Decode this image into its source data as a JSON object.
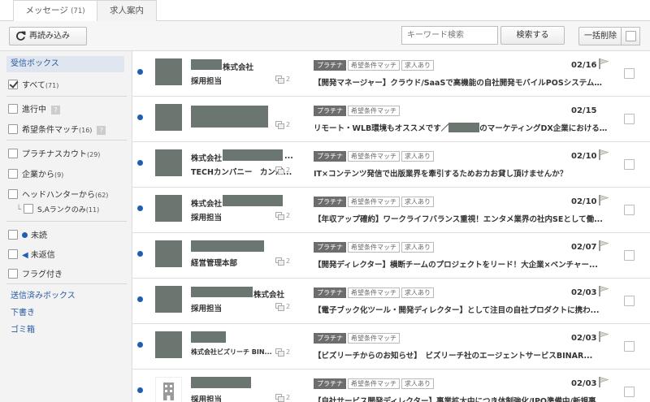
{
  "tabs": {
    "messages_label": "メッセージ",
    "messages_count": "(71)",
    "jobs_label": "求人案内"
  },
  "toolbar": {
    "reload_label": "再読み込み",
    "search_placeholder": "キーワード検索",
    "search_button": "検索する",
    "bulk_delete": "一括削除"
  },
  "sidebar": {
    "inbox": "受信ボックス",
    "all_label": "すべて",
    "all_count": "(71)",
    "in_progress": "進行中",
    "match": "希望条件マッチ",
    "match_count": "(16)",
    "platinum_scout": "プラチナスカウト",
    "platinum_count": "(29)",
    "from_company": "企業から",
    "from_company_count": "(9)",
    "headhunter": "ヘッドハンターから",
    "headhunter_count": "(62)",
    "s_rank": "S,Aランクのみ",
    "s_rank_count": "(11)",
    "unread": "未読",
    "unreplied": "未返信",
    "flagged": "フラグ付き",
    "sent": "送信済みボックス",
    "drafts": "下書き",
    "trash": "ゴミ箱",
    "help_mark": "?"
  },
  "tag_labels": {
    "platinum": "プラチナ",
    "match": "希望条件マッチ",
    "job": "求人あり"
  },
  "messages": [
    {
      "sender": "株式会社",
      "sub": "採用担当",
      "attach": "2",
      "date": "02/16",
      "subject": "【開発マネージャー】クラウド/SaaSで高機能の自社開発モバイルPOSシステムを..."
    },
    {
      "sender": "",
      "sub": "",
      "attach": "2",
      "date": "02/15",
      "subject_a": "リモート・WLB環境もオススメです／",
      "subject_b": "のマーケティングDX企業における..."
    },
    {
      "sender": "株式会社",
      "sender_tail": "...",
      "sub": "TECHカンパニー　カンパ...",
      "attach": "2",
      "date": "02/10",
      "subject": "IT×コンテンツ発信で出版業界を牽引するためおカお貸し頂けませんか？"
    },
    {
      "sender": "株式会社",
      "sub": "採用担当",
      "attach": "2",
      "date": "02/10",
      "subject": "【年収アップ確約】ワークライフバランス重視！エンタメ業界の社内SEとして働..."
    },
    {
      "sender": "",
      "sub": "経営管理本部",
      "attach": "2",
      "date": "02/07",
      "subject": "【開発ディレクター】横断チームのプロジェクトをリード！大企業×ベンチャー..."
    },
    {
      "sender": "株式会社",
      "sub": "採用担当",
      "attach": "2",
      "date": "02/03",
      "subject": "【電子ブック化ツール・開発ディレクター】として注目の自社プロダクトに携わ..."
    },
    {
      "sender": "",
      "sub": "株式会社ビズリーチ BIN...",
      "attach": "2",
      "date": "02/03",
      "subject": "【ビズリーチからのお知らせ】　ビズリーチ社のエージェントサービスBINAR..."
    },
    {
      "sender": "",
      "sub": "採用担当",
      "attach": "2",
      "date": "02/03",
      "subject": "【自社サービス開発ディレクター】事業拡大中につき体制強化/IPO準備中/新規事..."
    }
  ]
}
